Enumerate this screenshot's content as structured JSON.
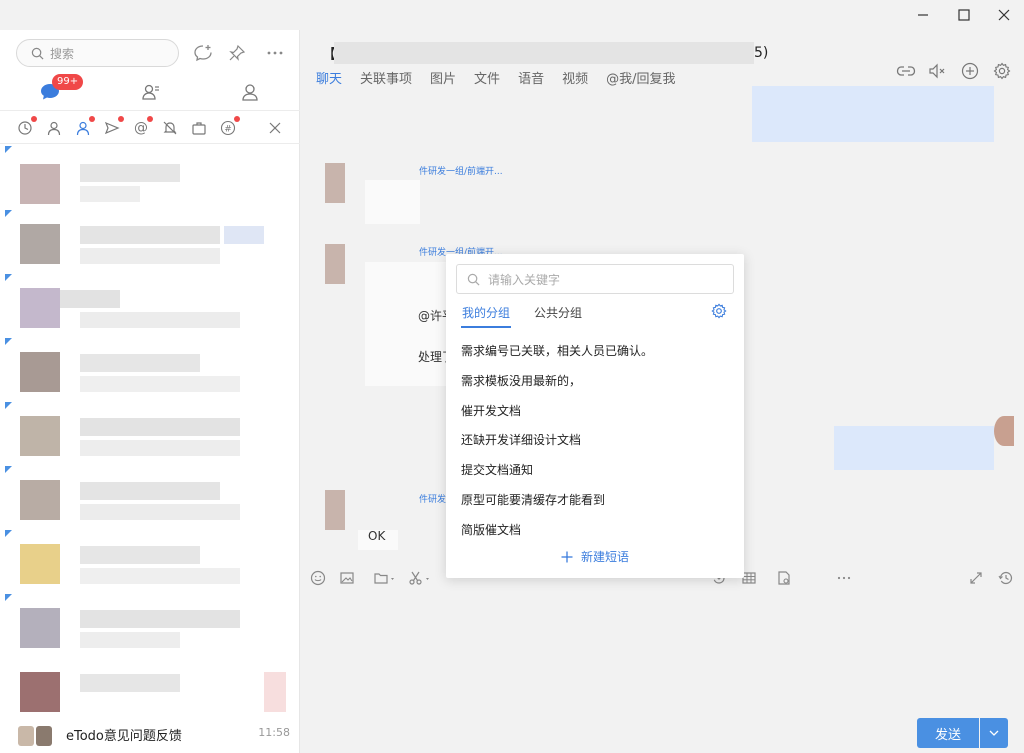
{
  "window": {
    "minimize": "—",
    "maximize": "☐",
    "close": "✕"
  },
  "sidebar": {
    "search_placeholder": "搜索",
    "badge_count": "99+",
    "last_conversation": {
      "name": "eTodo意见问题反馈",
      "time": "11:58"
    }
  },
  "chat": {
    "title_prefix": "【",
    "title_suffix": "5)",
    "tabs": [
      "聊天",
      "关联事项",
      "图片",
      "文件",
      "语音",
      "视频",
      "@我/回复我"
    ],
    "active_tab": "聊天",
    "messages": {
      "sender_1": "件研发一组/前端开...",
      "sender_2": "件研发一组/前端开...",
      "sender_3": "件研发",
      "fragment_mention": "@许平",
      "fragment_handle": "处理了",
      "fragment_ok": "OK"
    }
  },
  "popup": {
    "search_placeholder": "请输入关键字",
    "tabs": {
      "mine": "我的分组",
      "public": "公共分组"
    },
    "phrases": [
      "需求编号已关联，相关人员已确认。",
      "需求模板没用最新的，",
      "催开发文档",
      "还缺开发详细设计文档",
      "提交文档通知",
      "原型可能要清缓存才能看到",
      "简版催文档"
    ],
    "new_phrase": "新建短语"
  },
  "composer": {
    "send_label": "发送"
  },
  "colors": {
    "accent": "#3b7ddd",
    "send": "#4a90e2",
    "badge": "#f04848"
  }
}
